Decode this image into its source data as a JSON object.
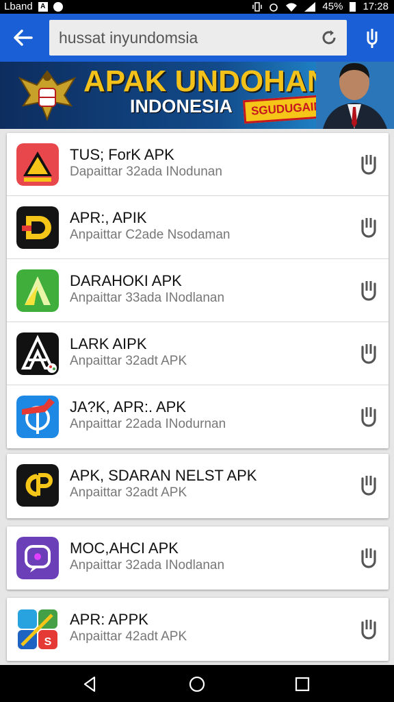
{
  "status_bar": {
    "carrier": "Lband",
    "notif_a": "A",
    "battery": "45%",
    "time": "17:28"
  },
  "search": {
    "value": "hussat inyundomsia"
  },
  "banner": {
    "title": "APAK UNDOHAN",
    "subtitle": "INDONESIA",
    "badge": "SGUDUGAIN"
  },
  "apps": [
    {
      "title": "TUS; ForK APK",
      "subtitle": "Dapaittar 32ada INodunan",
      "icon": "warning-triangle-icon"
    },
    {
      "title": "APR:, APIK",
      "subtitle": "Anpaittar C2ade Nsodaman",
      "icon": "d-logo-icon"
    },
    {
      "title": "DARAHOKI APK",
      "subtitle": "Anpaittar 33ada INodlanan",
      "icon": "green-a-logo-icon"
    },
    {
      "title": "LARK AIPK",
      "subtitle": "Anpaittar 32adt APK",
      "icon": "black-a-logo-icon"
    },
    {
      "title": "JA?K, APR:. APK",
      "subtitle": "Anpaittar 22ada INodurnan",
      "icon": "blue-tag-logo-icon"
    },
    {
      "title": "APK, SDARAN NELST APK",
      "subtitle": "Anpaittar 32adt APK",
      "icon": "cp-logo-icon"
    },
    {
      "title": "MOC,AHCI APK",
      "subtitle": "Anpaittar 32ada INodlanan",
      "icon": "purple-chat-logo-icon"
    },
    {
      "title": "APR: APPK",
      "subtitle": "Anpaittar 42adt APK",
      "icon": "colorful-tiles-logo-icon"
    }
  ],
  "colors": {
    "toolbar": "#1a5fd6",
    "banner_title": "#f2c21a",
    "badge_bg": "#f5c518",
    "badge_border": "#c6161f"
  }
}
